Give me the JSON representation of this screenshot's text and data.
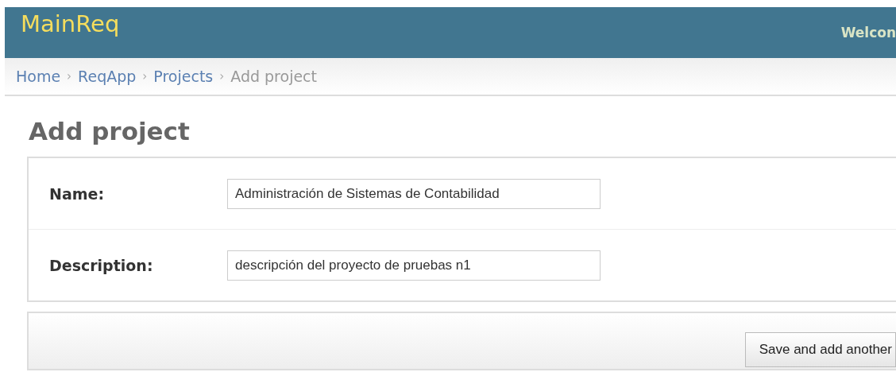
{
  "header": {
    "brand": "MainReq",
    "welcome": "Welcon"
  },
  "breadcrumbs": [
    {
      "label": "Home",
      "link": true
    },
    {
      "label": "ReqApp",
      "link": true
    },
    {
      "label": "Projects",
      "link": true
    },
    {
      "label": "Add project",
      "link": false
    }
  ],
  "separator": "›",
  "title": "Add project",
  "fields": [
    {
      "label": "Name:",
      "value": "Administración de Sistemas de Contabilidad"
    },
    {
      "label": "Description:",
      "value": "descripción del proyecto de pruebas n1"
    }
  ],
  "buttons": [
    "Save and add another"
  ]
}
